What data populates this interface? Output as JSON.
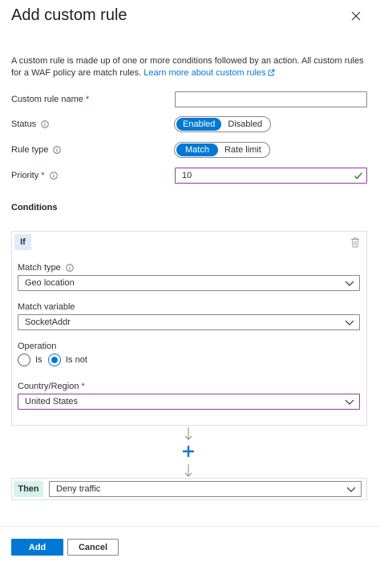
{
  "panel": {
    "title": "Add custom rule",
    "description": "A custom rule is made up of one or more conditions followed by an action. All custom rules for a WAF policy are match rules.",
    "learn_more": "Learn more about custom rules"
  },
  "fields": {
    "rule_name": {
      "label": "Custom rule name",
      "required_mark": "*",
      "value": ""
    },
    "status": {
      "label": "Status",
      "options": [
        "Enabled",
        "Disabled"
      ],
      "selected": "Enabled"
    },
    "rule_type": {
      "label": "Rule type",
      "options": [
        "Match",
        "Rate limit"
      ],
      "selected": "Match"
    },
    "priority": {
      "label": "Priority",
      "required_mark": "*",
      "value": "10"
    }
  },
  "conditions": {
    "heading": "Conditions",
    "if_label": "If",
    "match_type": {
      "label": "Match type",
      "value": "Geo location"
    },
    "match_variable": {
      "label": "Match variable",
      "value": "SocketAddr"
    },
    "operation": {
      "label": "Operation",
      "options": [
        "Is",
        "Is not"
      ],
      "selected": "Is not"
    },
    "country": {
      "label": "Country/Region",
      "required_mark": "*",
      "value": "United States"
    }
  },
  "action": {
    "then_label": "Then",
    "value": "Deny traffic"
  },
  "footer": {
    "add_label": "Add",
    "cancel_label": "Cancel"
  },
  "colors": {
    "accent": "#0078d4",
    "valid_border": "#8f3c9b",
    "check": "#107c10",
    "required": "#a4262c"
  }
}
